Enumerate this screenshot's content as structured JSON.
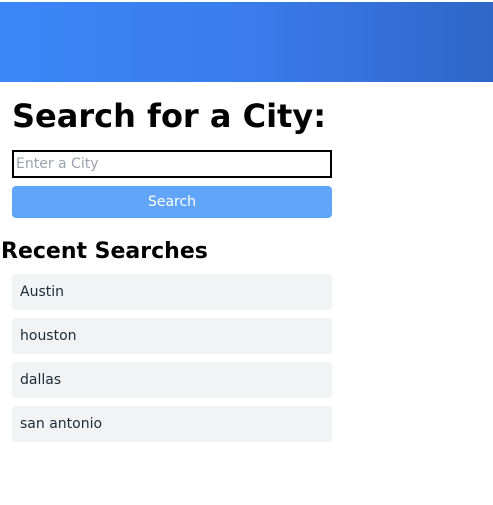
{
  "header": {
    "gradient_start": "#3b86f7",
    "gradient_end": "#2f66c8"
  },
  "main": {
    "title": "Search for a City:",
    "search_input": {
      "placeholder": "Enter a City",
      "value": ""
    },
    "search_button_label": "Search",
    "search_button_color": "#60a5fa"
  },
  "recent": {
    "title": "Recent Searches",
    "items": [
      {
        "label": "Austin"
      },
      {
        "label": "houston"
      },
      {
        "label": "dallas"
      },
      {
        "label": "san antonio"
      }
    ],
    "item_background": "#f2f3f5"
  }
}
